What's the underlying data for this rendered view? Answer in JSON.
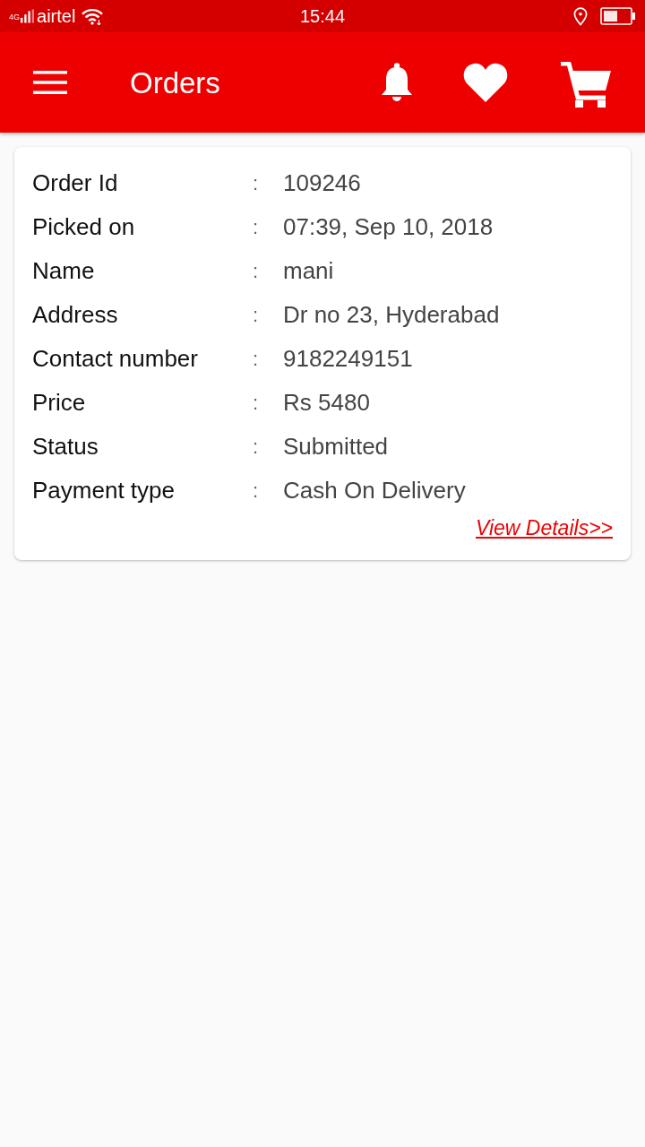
{
  "status_bar": {
    "network": "4G",
    "carrier": "airtel",
    "time": "15:44"
  },
  "app_bar": {
    "title": "Orders"
  },
  "order": {
    "rows": [
      {
        "label": "Order Id",
        "separator": ":",
        "value": "109246"
      },
      {
        "label": "Picked on",
        "separator": ":",
        "value": "07:39, Sep 10, 2018"
      },
      {
        "label": "Name",
        "separator": ":",
        "value": "mani"
      },
      {
        "label": "Address",
        "separator": ":",
        "value": "Dr no 23, Hyderabad"
      },
      {
        "label": "Contact number",
        "separator": ":",
        "value": "9182249151"
      },
      {
        "label": "Price",
        "separator": ":",
        "value": "Rs 5480"
      },
      {
        "label": "Status",
        "separator": ":",
        "value": "Submitted"
      },
      {
        "label": "Payment type",
        "separator": ":",
        "value": "Cash On Delivery"
      }
    ],
    "link": "View Details>>"
  }
}
